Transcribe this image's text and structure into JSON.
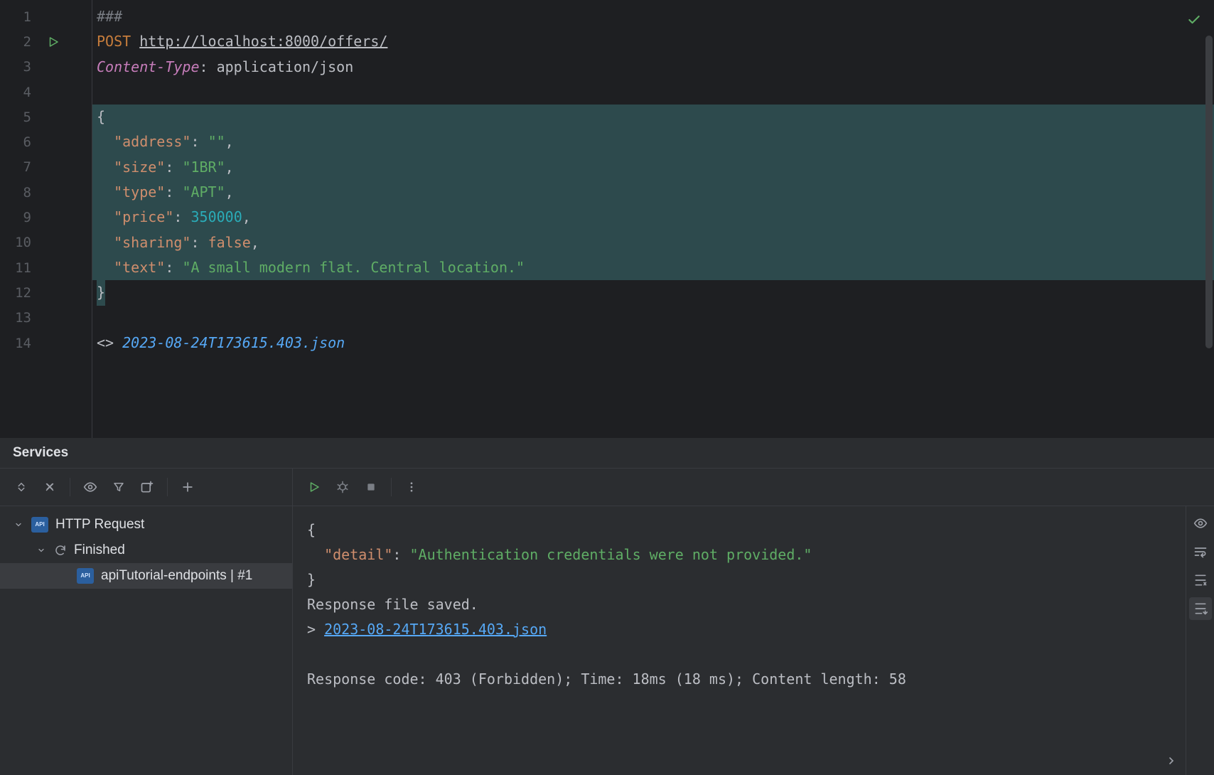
{
  "editor": {
    "lines": [
      "1",
      "2",
      "3",
      "4",
      "5",
      "6",
      "7",
      "8",
      "9",
      "10",
      "11",
      "12",
      "13",
      "14"
    ],
    "run_on_line": 2,
    "code": {
      "separator": "###",
      "method": "POST",
      "url": "http://localhost:8000/offers/",
      "header_name": "Content-Type",
      "header_value": "application/json",
      "body": {
        "open": "{",
        "k_address": "\"address\"",
        "v_address": "\"\"",
        "k_size": "\"size\"",
        "v_size": "\"1BR\"",
        "k_type": "\"type\"",
        "v_type": "\"APT\"",
        "k_price": "\"price\"",
        "v_price": "350000",
        "k_sharing": "\"sharing\"",
        "v_sharing": "false",
        "k_text": "\"text\"",
        "v_text": "\"A small modern flat. Central location.\"",
        "close": "}"
      },
      "angles": "<>",
      "response_file": "2023-08-24T173615.403.json"
    }
  },
  "services": {
    "title": "Services",
    "tree": {
      "root": "HTTP Request",
      "finished": "Finished",
      "leaf": "apiTutorial-endpoints | #1"
    },
    "response": {
      "open": "{",
      "key_detail": "\"detail\"",
      "val_detail": "\"Authentication credentials were not provided.\"",
      "close": "}",
      "saved_text": "Response file saved.",
      "caret": ">",
      "file_link": "2023-08-24T173615.403.json",
      "status_line": "Response code: 403 (Forbidden); Time: 18ms (18 ms); Content length: 58"
    }
  }
}
